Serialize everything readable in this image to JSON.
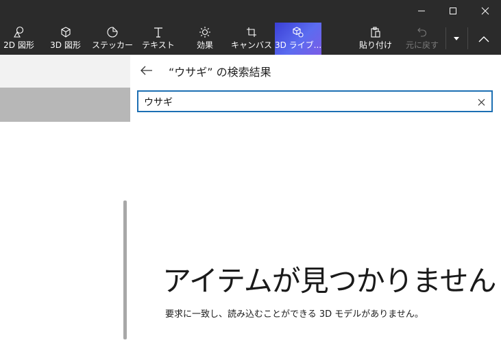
{
  "window": {
    "minimize_icon": "minimize-icon",
    "maximize_icon": "maximize-icon",
    "close_icon": "close-icon"
  },
  "ribbon": {
    "tools": [
      {
        "label": "2D 図形",
        "icon": "shapes-2d-icon"
      },
      {
        "label": "3D 図形",
        "icon": "cube-3d-icon"
      },
      {
        "label": "ステッカー",
        "icon": "sticker-icon"
      },
      {
        "label": "テキスト",
        "icon": "text-icon"
      },
      {
        "label": "効果",
        "icon": "effects-sun-icon"
      },
      {
        "label": "キャンバス",
        "icon": "canvas-crop-icon"
      },
      {
        "label": "3D ライブ...",
        "icon": "library-3d-icon"
      }
    ],
    "paste_label": "貼り付け",
    "undo_label": "元に戻す"
  },
  "panel": {
    "title": "“ウサギ” の検索結果",
    "search": {
      "value": "ウサギ"
    },
    "empty_title": "アイテムが見つかりません",
    "empty_subtitle": "要求に一致し、読み込むことができる 3D モデルがありません。"
  },
  "colors": {
    "ribbon_bg": "#2b2b2b",
    "active_tool": "#4a56e2",
    "search_border": "#1c6fb3"
  }
}
